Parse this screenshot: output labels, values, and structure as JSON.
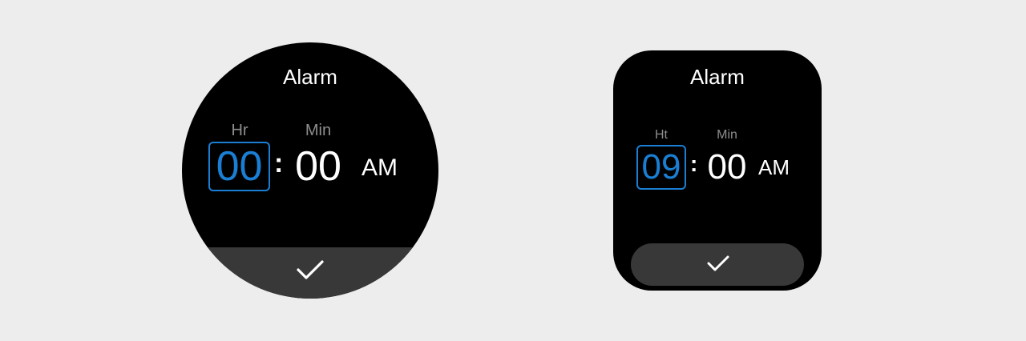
{
  "round_watch": {
    "title": "Alarm",
    "hour_label": "Hr",
    "minute_label": "Min",
    "hour_value": "00",
    "separator": ":",
    "minute_value": "00",
    "period": "AM",
    "confirm_icon": "check-icon"
  },
  "square_watch": {
    "title": "Alarm",
    "hour_label": "Ht",
    "minute_label": "Min",
    "hour_value": "09",
    "separator": ":",
    "minute_value": "00",
    "period": "AM",
    "confirm_icon": "check-icon"
  },
  "colors": {
    "background": "#ededed",
    "screen": "#000000",
    "accent": "#1a7fd4",
    "label": "#8d8d8d",
    "button": "#383838"
  }
}
